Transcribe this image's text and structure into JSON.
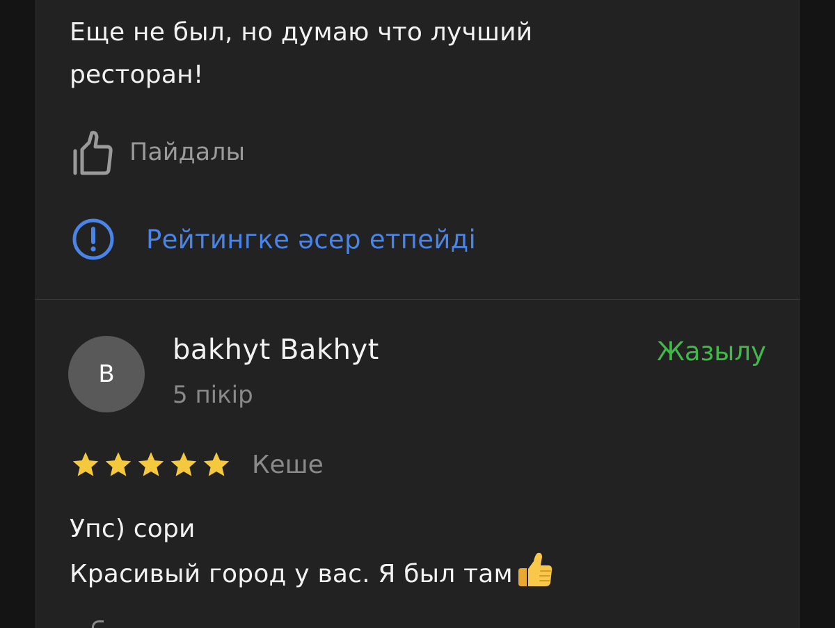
{
  "review1": {
    "text_lines": [
      "Еще не был, но думаю что лучший",
      "ресторан!"
    ],
    "helpful_label": "Пайдалы",
    "notice_label": "Рейтингке әсер етпейді"
  },
  "review2": {
    "avatar_letter": "B",
    "author": "bakhyt Bakhyt",
    "review_count": "5 пікір",
    "subscribe_label": "Жазылу",
    "rating": 5,
    "date": "Кеше",
    "text_lines": [
      "Упс) сори",
      "Красивый город у вас. Я был там"
    ]
  },
  "colors": {
    "background": "#222222",
    "outer_background": "#141414",
    "link_blue": "#4a84e6",
    "subscribe_green": "#43b84a",
    "star_yellow": "#f5c93e",
    "muted_text": "#8a8a8a"
  },
  "icons": {
    "helpful": "thumbs-up-icon",
    "notice": "exclamation-circle-icon",
    "star": "star-icon",
    "emoji": "thumbs-up-emoji"
  }
}
